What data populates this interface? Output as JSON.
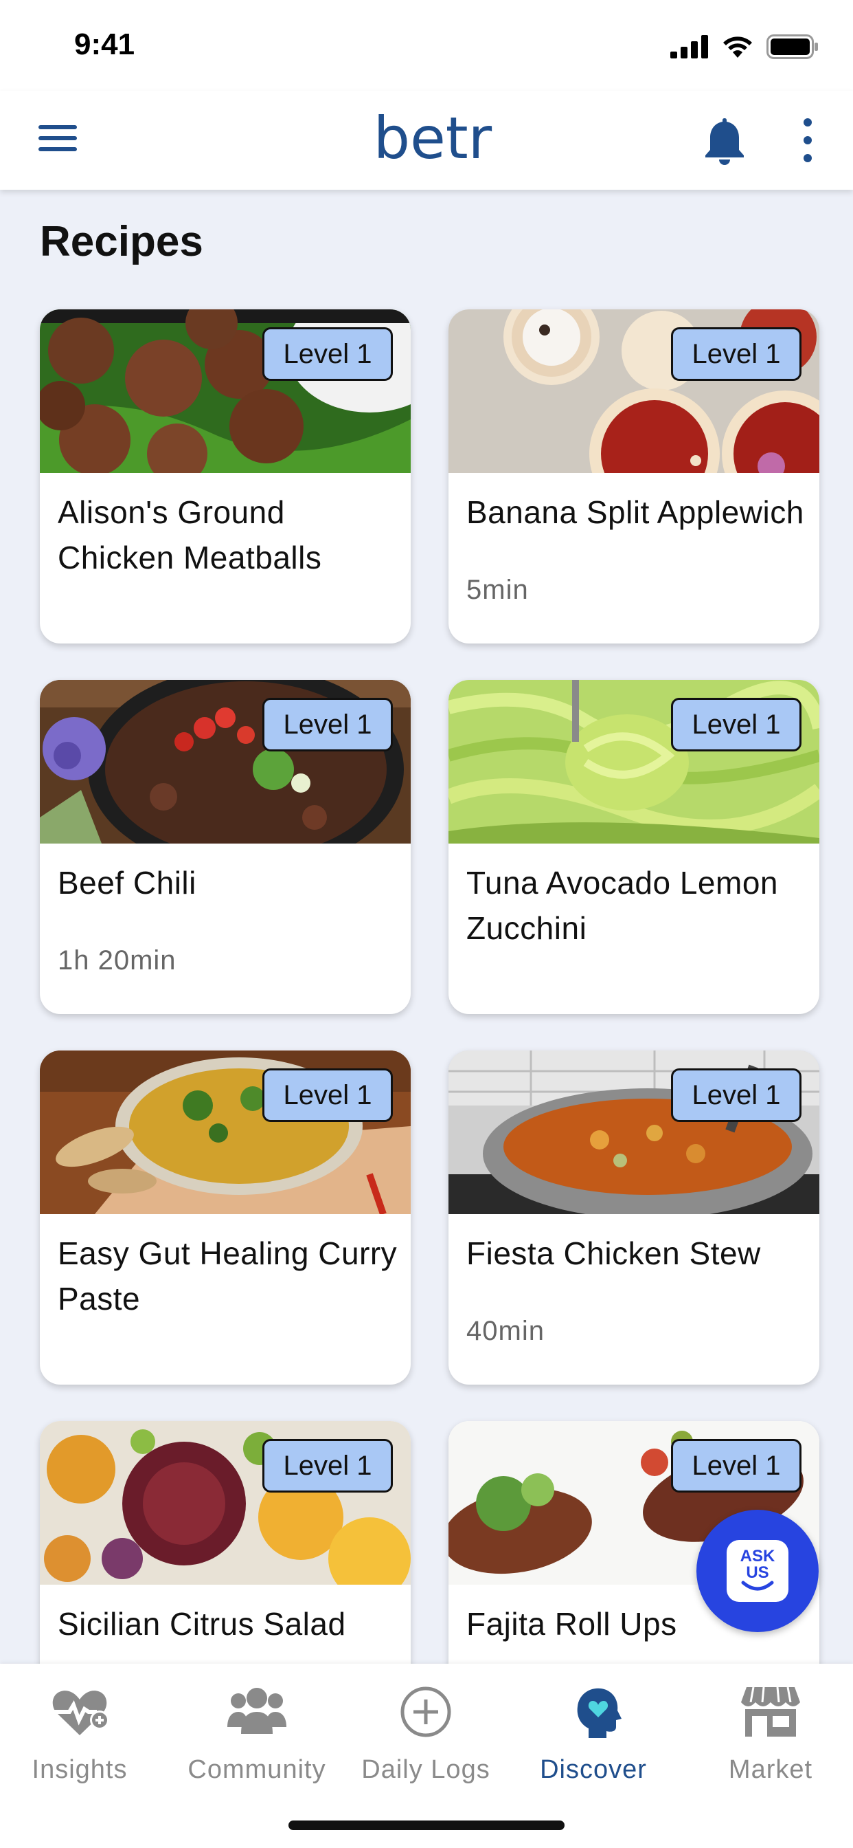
{
  "status_bar": {
    "time": "9:41"
  },
  "header": {
    "logo_text": "betr"
  },
  "page": {
    "title": "Recipes"
  },
  "recipes": [
    {
      "title": "Alison's Ground Chicken Meatballs",
      "time": "",
      "level": "Level 1"
    },
    {
      "title": "Banana Split Applewich",
      "time": "5min",
      "level": "Level 1"
    },
    {
      "title": "Beef Chili",
      "time": "1h 20min",
      "level": "Level 1"
    },
    {
      "title": "Tuna Avocado Lemon Zucchini",
      "time": "",
      "level": "Level 1"
    },
    {
      "title": "Easy Gut Healing Curry Paste",
      "time": "",
      "level": "Level 1"
    },
    {
      "title": "Fiesta Chicken Stew",
      "time": "40min",
      "level": "Level 1"
    },
    {
      "title": "Sicilian Citrus Salad",
      "time": "",
      "level": "Level 1"
    },
    {
      "title": "Fajita Roll Ups",
      "time": "",
      "level": "Level 1"
    }
  ],
  "ask_button": {
    "label_line1": "ASK",
    "label_line2": "US"
  },
  "bottom_nav": {
    "items": [
      {
        "label": "Insights",
        "icon": "heart-pulse-icon",
        "active": false
      },
      {
        "label": "Community",
        "icon": "people-icon",
        "active": false
      },
      {
        "label": "Daily Logs",
        "icon": "plus-circle-icon",
        "active": false
      },
      {
        "label": "Discover",
        "icon": "head-heart-icon",
        "active": true
      },
      {
        "label": "Market",
        "icon": "storefront-icon",
        "active": false
      }
    ]
  },
  "colors": {
    "brand": "#1f4e8c",
    "background": "#edf0f8",
    "badge": "#a9c8f5",
    "ask_button": "#2744e0",
    "nav_inactive": "#8a8a8a"
  }
}
